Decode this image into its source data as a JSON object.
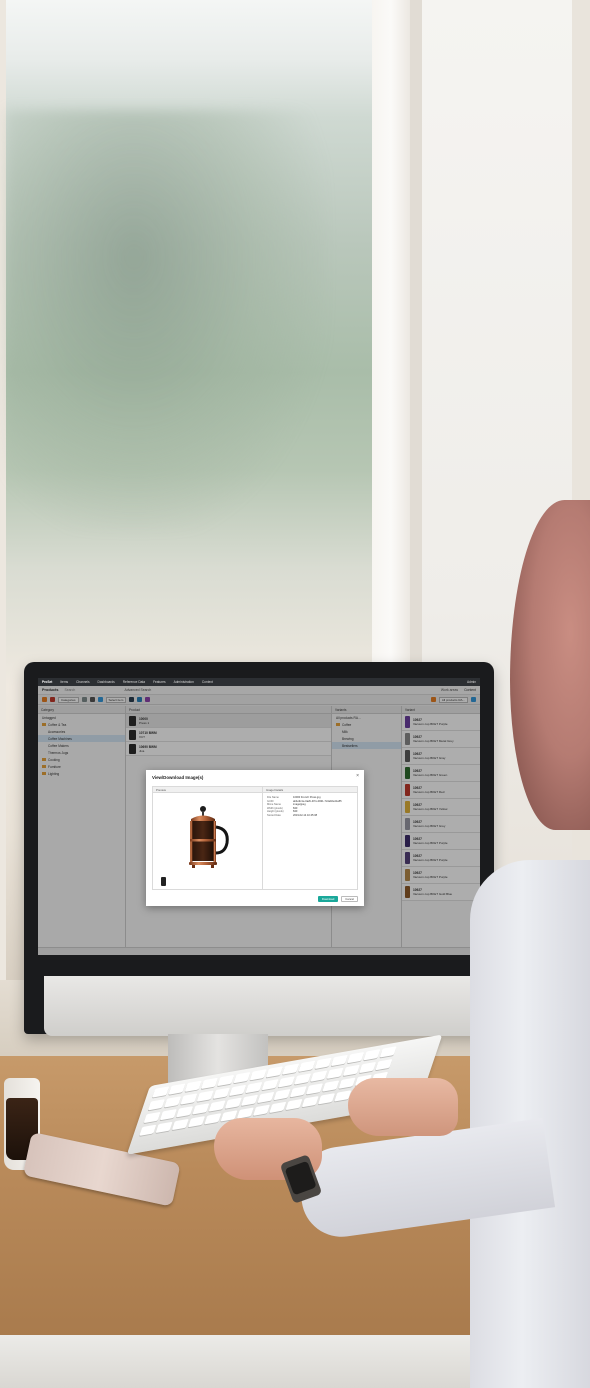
{
  "app": {
    "nav_tabs": [
      "ProSet",
      "Items",
      "Channels",
      "Dashboards",
      "Reference Data",
      "Features",
      "Administration",
      "Context"
    ],
    "nav_right": [
      "Admin"
    ],
    "section_title": "Products",
    "search_placeholder": "Search",
    "advanced_search": "Advanced Search",
    "workarea_label": "Work areas",
    "workarea_value": "Content",
    "toolbar": {
      "categories_label": "Categories",
      "select_label": "Select item",
      "variants_label": "All products RA..."
    },
    "category_panel": {
      "header": "Category",
      "items": [
        {
          "label": "Untagged",
          "level": 0
        },
        {
          "label": "Coffee & Tea",
          "level": 0
        },
        {
          "label": "Accessories",
          "level": 1
        },
        {
          "label": "Coffee Machines",
          "level": 1,
          "selected": true
        },
        {
          "label": "Coffee Makers",
          "level": 1
        },
        {
          "label": "Thermos Jugs",
          "level": 1
        },
        {
          "label": "Cooking",
          "level": 0
        },
        {
          "label": "Furniture",
          "level": 0
        },
        {
          "label": "Lighting",
          "level": 0
        }
      ],
      "filter_placeholder": "Filter Items..."
    },
    "product_panel": {
      "header": "Product",
      "rows": [
        {
          "id": "10000",
          "name": "Press 1"
        },
        {
          "id": "10710 BWM",
          "name": "XCT"
        },
        {
          "id": "10690 BWM",
          "name": "Jiva"
        }
      ],
      "filter_placeholder": "Filter Items..."
    },
    "variant_panel": {
      "header": "Variants",
      "items": [
        {
          "label": "All products RA...",
          "level": 0
        },
        {
          "label": "Coffee",
          "level": 1
        },
        {
          "label": "Milk",
          "level": 2
        },
        {
          "label": "Brewing",
          "level": 2
        },
        {
          "label": "Bestsellers",
          "level": 2
        }
      ],
      "filter_placeholder": "Filter Items..."
    },
    "attachment_panel": {
      "header": "Variant",
      "rows": [
        {
          "id": "10927",
          "desc": "Vacuum cup BKET Purple",
          "color": "#6b3fa0"
        },
        {
          "id": "10927",
          "desc": "Vacuum cup BKET Metal Grey",
          "color": "#8a8a8a"
        },
        {
          "id": "10927",
          "desc": "Vacuum cup BKET Gray",
          "color": "#5a5a5a"
        },
        {
          "id": "10927",
          "desc": "Vacuum cup BKET Green",
          "color": "#2f6b2f"
        },
        {
          "id": "10927",
          "desc": "Vacuum cup BKET Red",
          "color": "#c0392b"
        },
        {
          "id": "10927",
          "desc": "Vacuum cup BKET Yellow",
          "color": "#e2b33a"
        },
        {
          "id": "10927",
          "desc": "Vacuum cup BKET Grey",
          "color": "#9a9aa5"
        },
        {
          "id": "10927",
          "desc": "Vacuum cup BKET Purple",
          "color": "#3d2d6b"
        },
        {
          "id": "10927",
          "desc": "Vacuum cup BKET Purple",
          "color": "#54427a"
        },
        {
          "id": "10927",
          "desc": "Vacuum cup BKET Purple",
          "color": "#b58a4a"
        },
        {
          "id": "10927",
          "desc": "Vacuum cup BKET Gold Blue",
          "color": "#8e5a2a"
        }
      ],
      "filter_placeholder": "Filter Items..."
    },
    "dialog": {
      "title": "View/Download Image(s)",
      "close": "×",
      "left_header": "Preview",
      "right_header": "Image Details",
      "details": [
        {
          "k": "File Name",
          "v": "10000 French Press.jpg"
        },
        {
          "k": "GUID",
          "v": "ab4e9c1e-0a2b-4f7e-b8d1-7c3a92e41a55"
        },
        {
          "k": "Mime Name",
          "v": "image/jpeg"
        },
        {
          "k": "Width (pixels)",
          "v": "840"
        },
        {
          "k": "Height (pixels)",
          "v": "840"
        },
        {
          "k": "Stored Date",
          "v": "2019-02-14 10:45:08"
        }
      ],
      "download_button": "Download",
      "cancel_button": "Cancel"
    }
  }
}
